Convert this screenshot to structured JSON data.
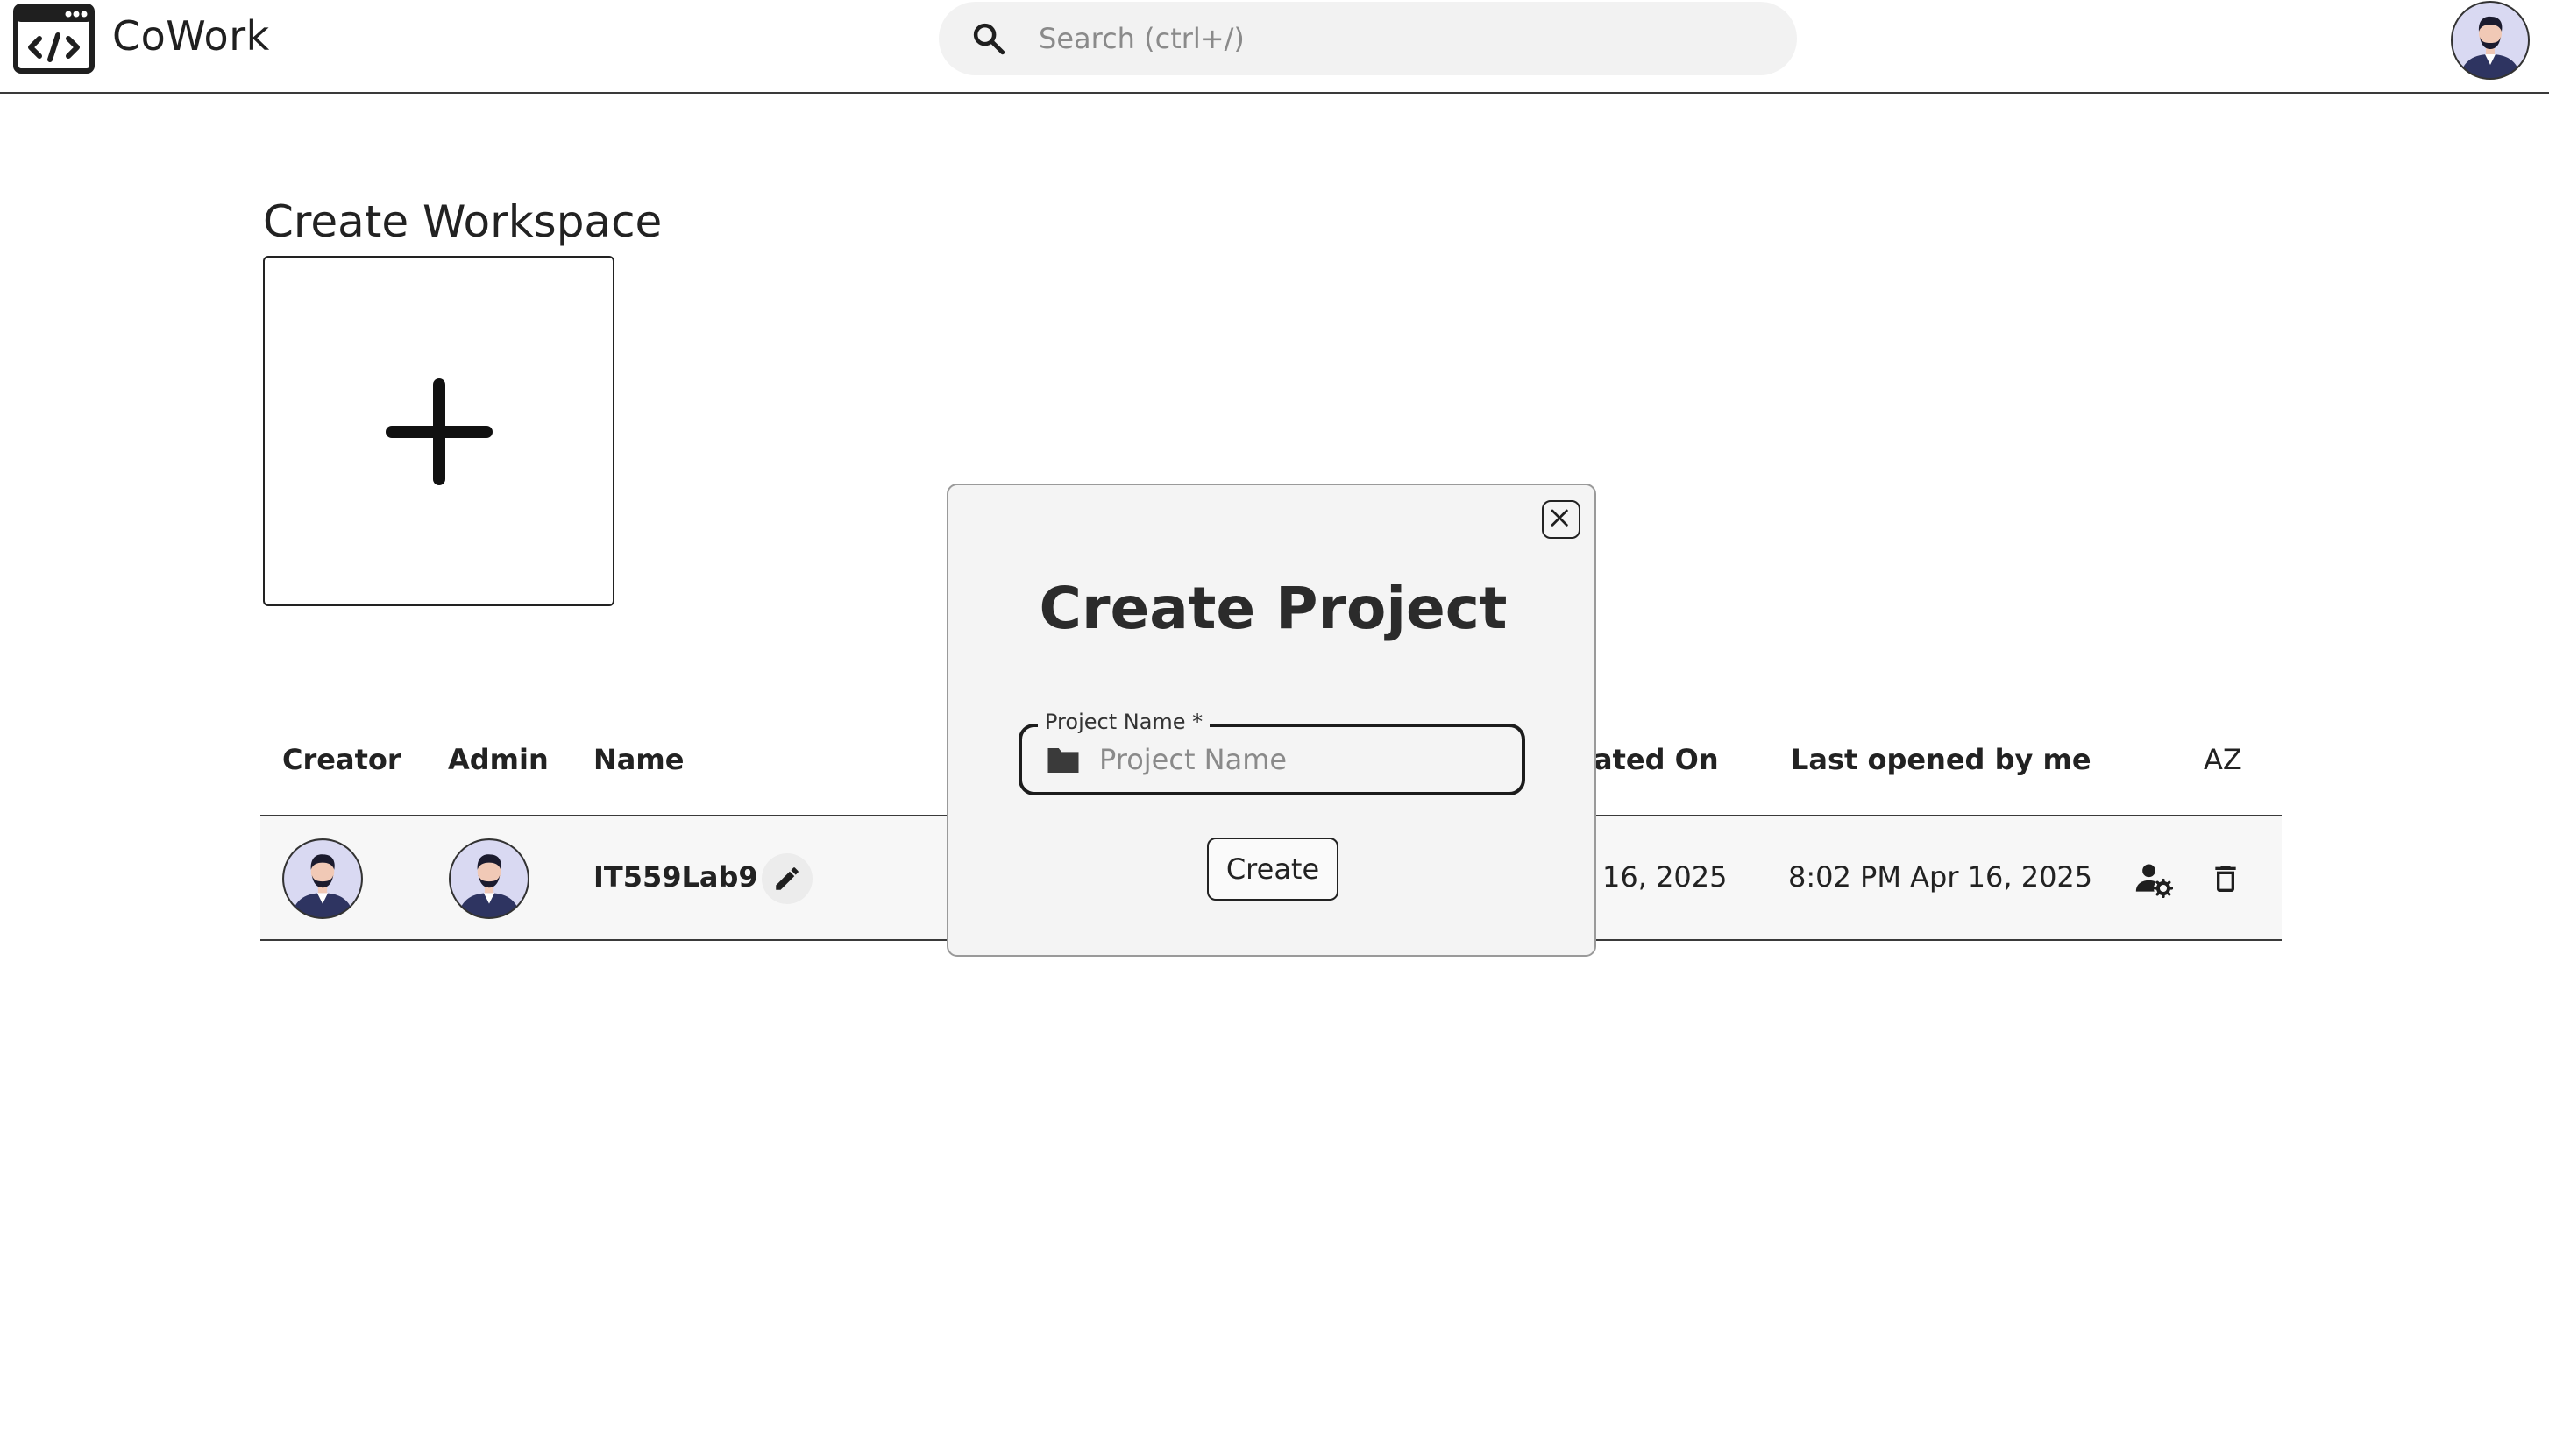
{
  "app": {
    "brand": "CoWork"
  },
  "search": {
    "placeholder": "Search (ctrl+/)"
  },
  "workspace": {
    "section_title": "Create Workspace"
  },
  "table": {
    "headers": {
      "creator": "Creator",
      "admin": "Admin",
      "name": "Name",
      "created_on": "ated On",
      "last_opened": "Last opened by me",
      "sort": "AZ"
    },
    "rows": [
      {
        "name": "IT559Lab9",
        "created_on": "16, 2025",
        "last_opened": "8:02 PM Apr 16, 2025"
      }
    ]
  },
  "modal": {
    "title": "Create Project",
    "field_label": "Project Name *",
    "field_placeholder": "Project Name",
    "field_value": "",
    "create_label": "Create"
  },
  "colors": {
    "avatar_bg": "#d9d9f2",
    "avatar_suit": "#2e3461",
    "text_primary": "#222222"
  }
}
